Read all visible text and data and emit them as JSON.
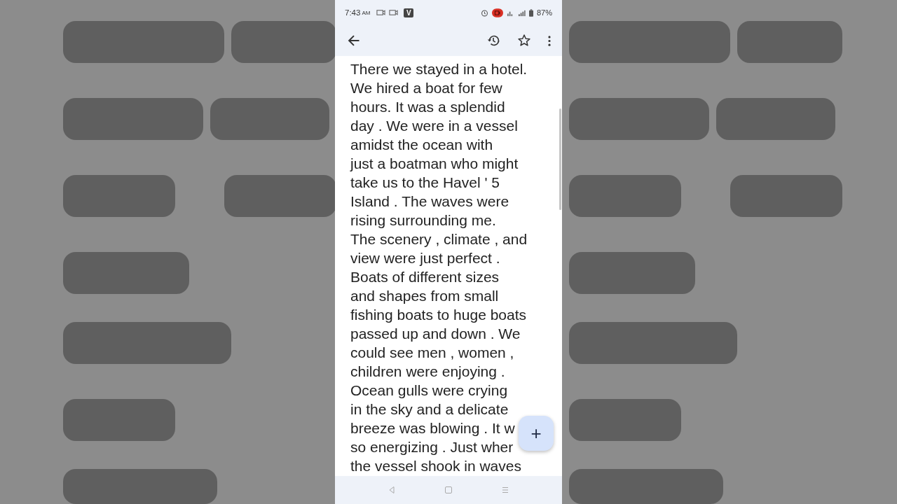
{
  "status_bar": {
    "time": "7:43",
    "meridiem": "AM",
    "app_badge": "V",
    "battery": "87%"
  },
  "document": {
    "lines": [
      "There we stayed in a hotel.",
      "We hired a boat for few",
      "hours. It was a splendid",
      "day . We were in a vessel",
      "amidst the ocean with",
      "just a boatman who might",
      "take us to the Havel ' 5",
      "Island . The waves were",
      "rising surrounding me.",
      "The scenery , climate , and",
      "view were just perfect .",
      "Boats of different sizes",
      "and shapes from small",
      "fishing boats to huge boats",
      "passed up and down . We",
      "could see men , women ,",
      "children were enjoying .",
      "Ocean gulls were crying",
      "in the sky and a delicate",
      "breeze was blowing . It w",
      "so energizing . Just wher",
      "the vessel shook in waves"
    ]
  },
  "fab": {
    "label": "+"
  }
}
